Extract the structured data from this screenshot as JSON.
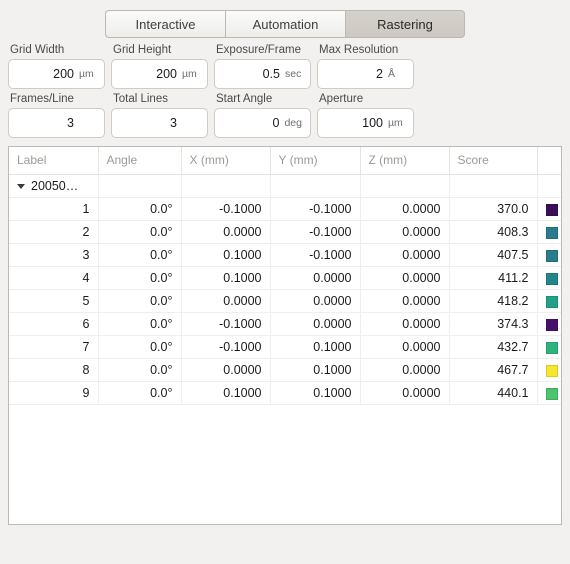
{
  "tabs": [
    {
      "label": "Interactive",
      "active": false
    },
    {
      "label": "Automation",
      "active": false
    },
    {
      "label": "Rastering",
      "active": true
    }
  ],
  "fields": [
    [
      {
        "label": "Grid Width",
        "value": "200",
        "unit": "µm",
        "placeholder": "200"
      },
      {
        "label": "Grid Height",
        "value": "200",
        "unit": "µm",
        "placeholder": "200"
      },
      {
        "label": "Exposure/Frame",
        "value": "0.5",
        "unit": "sec",
        "placeholder": "0.5"
      },
      {
        "label": "Max Resolution",
        "value": "2",
        "unit": "Å",
        "placeholder": "2"
      }
    ],
    [
      {
        "label": "Frames/Line",
        "value": "3",
        "unit": "",
        "placeholder": "3"
      },
      {
        "label": "Total Lines",
        "value": "3",
        "unit": "",
        "placeholder": "3"
      },
      {
        "label": "Start Angle",
        "value": "0",
        "unit": "deg",
        "placeholder": "0"
      },
      {
        "label": "Aperture",
        "value": "100",
        "unit": "µm",
        "placeholder": "100"
      }
    ]
  ],
  "table": {
    "columns": [
      "Label",
      "Angle",
      "X (mm)",
      "Y (mm)",
      "Z (mm)",
      "Score",
      ""
    ],
    "group": {
      "label": "20050…",
      "expanded": true
    },
    "rows": [
      {
        "label": "1",
        "angle": "0.0°",
        "x": "-0.1000",
        "y": "-0.1000",
        "z": "0.0000",
        "score": "370.0",
        "color": "#3b0f57"
      },
      {
        "label": "2",
        "angle": "0.0°",
        "x": "0.0000",
        "y": "-0.1000",
        "z": "0.0000",
        "score": "408.3",
        "color": "#2a7b8d"
      },
      {
        "label": "3",
        "angle": "0.0°",
        "x": "0.1000",
        "y": "-0.1000",
        "z": "0.0000",
        "score": "407.5",
        "color": "#2a7b8d"
      },
      {
        "label": "4",
        "angle": "0.0°",
        "x": "0.1000",
        "y": "0.0000",
        "z": "0.0000",
        "score": "411.2",
        "color": "#23868a"
      },
      {
        "label": "5",
        "angle": "0.0°",
        "x": "0.0000",
        "y": "0.0000",
        "z": "0.0000",
        "score": "418.2",
        "color": "#21a187"
      },
      {
        "label": "6",
        "angle": "0.0°",
        "x": "-0.1000",
        "y": "0.0000",
        "z": "0.0000",
        "score": "374.3",
        "color": "#46106b"
      },
      {
        "label": "7",
        "angle": "0.0°",
        "x": "-0.1000",
        "y": "0.1000",
        "z": "0.0000",
        "score": "432.7",
        "color": "#2eb37c"
      },
      {
        "label": "8",
        "angle": "0.0°",
        "x": "0.0000",
        "y": "0.1000",
        "z": "0.0000",
        "score": "467.7",
        "color": "#f5e62f"
      },
      {
        "label": "9",
        "angle": "0.0°",
        "x": "0.1000",
        "y": "0.1000",
        "z": "0.0000",
        "score": "440.1",
        "color": "#4bc46a"
      }
    ]
  },
  "colors": {
    "background": "#f2f1ef",
    "panel_border": "#bcb8b2",
    "tab_active": "#d0ccc6",
    "header_text": "#9a9a98"
  }
}
